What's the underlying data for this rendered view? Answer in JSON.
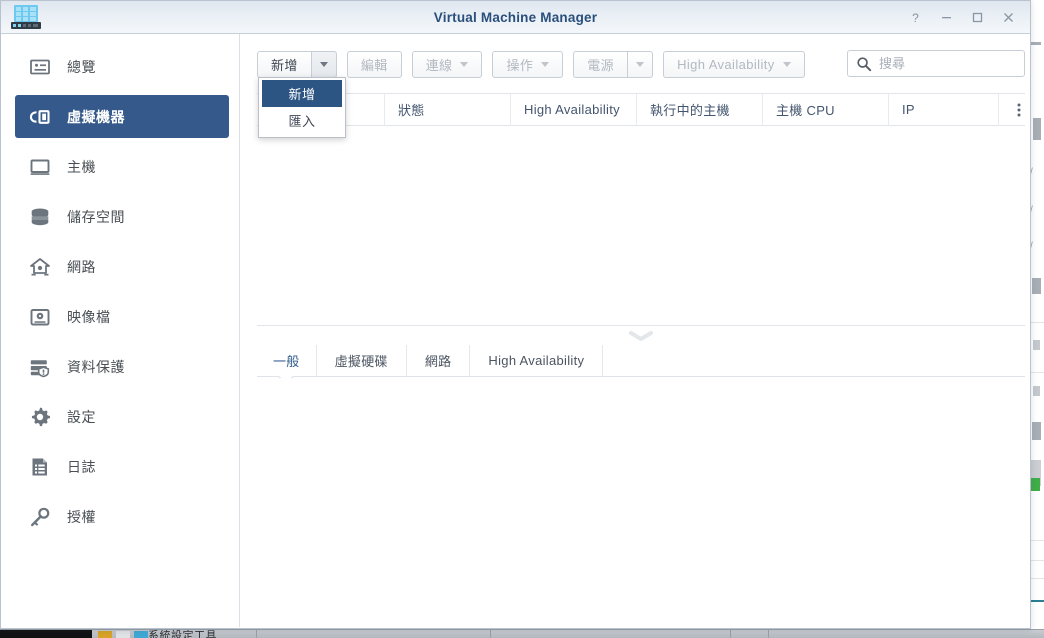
{
  "window": {
    "title": "Virtual Machine Manager",
    "app_icon": "server-rack-icon",
    "controls": [
      {
        "name": "help-button",
        "glyph": "?"
      },
      {
        "name": "minimize-button",
        "glyph": "–"
      },
      {
        "name": "maximize-button",
        "glyph": "□"
      },
      {
        "name": "close-button",
        "glyph": "×"
      }
    ]
  },
  "sidebar": {
    "items": [
      {
        "label": "總覽",
        "icon": "overview-card-icon",
        "active": false
      },
      {
        "label": "虛擬機器",
        "icon": "virtual-machine-icon",
        "active": true
      },
      {
        "label": "主機",
        "icon": "monitor-icon",
        "active": false
      },
      {
        "label": "儲存空間",
        "icon": "storage-disks-icon",
        "active": false
      },
      {
        "label": "網路",
        "icon": "network-home-icon",
        "active": false
      },
      {
        "label": "映像檔",
        "icon": "disk-image-icon",
        "active": false
      },
      {
        "label": "資料保護",
        "icon": "data-protection-shield-icon",
        "active": false
      },
      {
        "label": "設定",
        "icon": "gear-icon",
        "active": false
      },
      {
        "label": "日誌",
        "icon": "log-document-icon",
        "active": false
      },
      {
        "label": "授權",
        "icon": "key-icon",
        "active": false
      }
    ]
  },
  "toolbar": {
    "create_label": "新增",
    "create_arrow_icon": "chevron-down-icon",
    "edit_label": "編輯",
    "connect_label": "連線",
    "action_label": "操作",
    "power_label": "電源",
    "power_arrow_icon": "chevron-down-icon",
    "high_availability_label": "High Availability"
  },
  "dropdown": {
    "open": true,
    "items": [
      {
        "label": "新增",
        "selected": true
      },
      {
        "label": "匯入",
        "selected": false
      }
    ]
  },
  "search": {
    "placeholder": "搜尋",
    "value": "",
    "icon": "search-icon"
  },
  "table": {
    "columns": [
      {
        "label": "",
        "width": 128
      },
      {
        "label": "狀態",
        "width": 126
      },
      {
        "label": "High Availability",
        "width": 126
      },
      {
        "label": "執行中的主機",
        "width": 126
      },
      {
        "label": "主機 CPU",
        "width": 126
      },
      {
        "label": "IP",
        "width": 110
      }
    ],
    "overflow_icon": "kebab-menu-icon",
    "rows": []
  },
  "splitter": {
    "collapse_icon": "chevron-down-icon"
  },
  "detail_tabs": {
    "items": [
      {
        "label": "一般",
        "active": true
      },
      {
        "label": "虛擬硬碟",
        "active": false
      },
      {
        "label": "網路",
        "active": false
      },
      {
        "label": "High Availability",
        "active": false
      }
    ]
  },
  "desktop_taskbar": {
    "label": "系統設定工具"
  },
  "colors": {
    "accent": "#34598a",
    "menu_selected": "#2c5584",
    "title_text": "#2a4f7d",
    "header_text": "#43556e",
    "green_marker": "#3fae49"
  }
}
